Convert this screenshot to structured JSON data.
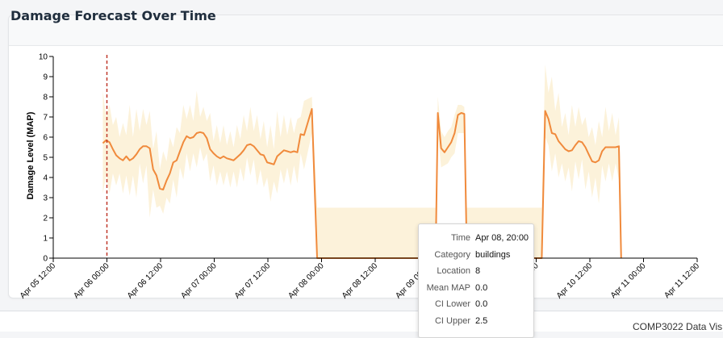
{
  "card": {
    "title": "Damage Forecast Over Time"
  },
  "footer": {
    "text": "COMP3022 Data Vis"
  },
  "colors": {
    "line": "#f08a3c",
    "band": "#fcf2da",
    "marker": "#c0392b",
    "axis": "#000000"
  },
  "tooltip": {
    "rows": [
      {
        "key": "Time",
        "value": "Apr 08, 20:00"
      },
      {
        "key": "Category",
        "value": "buildings"
      },
      {
        "key": "Location",
        "value": "8"
      },
      {
        "key": "Mean MAP",
        "value": "0.0"
      },
      {
        "key": "CI Lower",
        "value": "0.0"
      },
      {
        "key": "CI Upper",
        "value": "2.5"
      }
    ]
  },
  "chart_data": {
    "type": "line",
    "title": "Damage Forecast Over Time",
    "ylabel": "Damage Level (MAP)",
    "xlabel": "",
    "x_range": [
      "2020-04-05T12:00",
      "2020-04-11T12:00"
    ],
    "ylim": [
      0,
      10
    ],
    "y_ticks": [
      "0",
      "1",
      "2",
      "3",
      "4",
      "5",
      "6",
      "7",
      "8",
      "9",
      "10"
    ],
    "x_ticks": [
      {
        "t": "2020-04-05T12:00",
        "label": "Apr 05 12:00"
      },
      {
        "t": "2020-04-06T00:00",
        "label": "Apr 06 00:00"
      },
      {
        "t": "2020-04-06T12:00",
        "label": "Apr 06 12:00"
      },
      {
        "t": "2020-04-07T00:00",
        "label": "Apr 07 00:00"
      },
      {
        "t": "2020-04-07T12:00",
        "label": "Apr 07 12:00"
      },
      {
        "t": "2020-04-08T00:00",
        "label": "Apr 08 00:00"
      },
      {
        "t": "2020-04-08T12:00",
        "label": "Apr 08 12:00"
      },
      {
        "t": "2020-04-09T00:00",
        "label": "Apr 09 00:00"
      },
      {
        "t": "2020-04-09T12:00",
        "label": "Apr 09 12:00"
      },
      {
        "t": "2020-04-10T00:00",
        "label": "Apr 10 00:00"
      },
      {
        "t": "2020-04-10T12:00",
        "label": "Apr 10 12:00"
      },
      {
        "t": "2020-04-11T00:00",
        "label": "Apr 11 00:00"
      },
      {
        "t": "2020-04-11T12:00",
        "label": "Apr 11 12:00"
      }
    ],
    "marker_time": "2020-04-06T00:00",
    "series": [
      {
        "mean": [
          [
            "2020-04-05T23:05",
            5.7
          ],
          [
            "2020-04-05T23:50",
            5.85
          ],
          [
            "2020-04-06T00:35",
            5.75
          ],
          [
            "2020-04-06T01:20",
            5.4
          ],
          [
            "2020-04-06T02:05",
            5.1
          ],
          [
            "2020-04-06T02:50",
            4.95
          ],
          [
            "2020-04-06T03:35",
            4.85
          ],
          [
            "2020-04-06T04:20",
            5.05
          ],
          [
            "2020-04-06T05:05",
            4.85
          ],
          [
            "2020-04-06T05:50",
            4.95
          ],
          [
            "2020-04-06T06:35",
            5.15
          ],
          [
            "2020-04-06T07:20",
            5.4
          ],
          [
            "2020-04-06T08:05",
            5.55
          ],
          [
            "2020-04-06T08:50",
            5.55
          ],
          [
            "2020-04-06T09:35",
            5.45
          ],
          [
            "2020-04-06T10:20",
            4.4
          ],
          [
            "2020-04-06T11:05",
            4.1
          ],
          [
            "2020-04-06T11:50",
            3.45
          ],
          [
            "2020-04-06T12:35",
            3.4
          ],
          [
            "2020-04-06T13:20",
            3.85
          ],
          [
            "2020-04-06T14:05",
            4.2
          ],
          [
            "2020-04-06T14:50",
            4.75
          ],
          [
            "2020-04-06T15:35",
            4.85
          ],
          [
            "2020-04-06T16:20",
            5.3
          ],
          [
            "2020-04-06T17:05",
            5.75
          ],
          [
            "2020-04-06T17:50",
            6.05
          ],
          [
            "2020-04-06T18:35",
            5.95
          ],
          [
            "2020-04-06T19:20",
            6.0
          ],
          [
            "2020-04-06T20:05",
            6.2
          ],
          [
            "2020-04-06T20:50",
            6.25
          ],
          [
            "2020-04-06T21:35",
            6.2
          ],
          [
            "2020-04-06T22:20",
            5.95
          ],
          [
            "2020-04-06T23:05",
            5.4
          ],
          [
            "2020-04-06T23:50",
            5.2
          ],
          [
            "2020-04-07T00:35",
            5.05
          ],
          [
            "2020-04-07T01:20",
            4.95
          ],
          [
            "2020-04-07T02:05",
            5.05
          ],
          [
            "2020-04-07T02:50",
            4.95
          ],
          [
            "2020-04-07T03:35",
            4.9
          ],
          [
            "2020-04-07T04:20",
            4.85
          ],
          [
            "2020-04-07T05:05",
            5.0
          ],
          [
            "2020-04-07T05:50",
            5.15
          ],
          [
            "2020-04-07T06:35",
            5.35
          ],
          [
            "2020-04-07T07:20",
            5.6
          ],
          [
            "2020-04-07T08:05",
            5.65
          ],
          [
            "2020-04-07T08:50",
            5.55
          ],
          [
            "2020-04-07T09:35",
            5.35
          ],
          [
            "2020-04-07T10:20",
            5.15
          ],
          [
            "2020-04-07T11:05",
            5.1
          ],
          [
            "2020-04-07T11:50",
            4.75
          ],
          [
            "2020-04-07T12:35",
            4.7
          ],
          [
            "2020-04-07T13:20",
            4.65
          ],
          [
            "2020-04-07T14:05",
            5.05
          ],
          [
            "2020-04-07T14:50",
            5.2
          ],
          [
            "2020-04-07T15:35",
            5.35
          ],
          [
            "2020-04-07T16:20",
            5.3
          ],
          [
            "2020-04-07T17:05",
            5.25
          ],
          [
            "2020-04-07T17:50",
            5.3
          ],
          [
            "2020-04-07T18:35",
            5.25
          ],
          [
            "2020-04-07T19:20",
            6.15
          ],
          [
            "2020-04-07T20:05",
            6.1
          ],
          [
            "2020-04-07T21:50",
            7.4
          ],
          [
            "2020-04-07T23:00",
            0.0
          ],
          [
            "2020-04-09T00:00",
            0.0
          ],
          [
            "2020-04-09T01:30",
            0.0
          ],
          [
            "2020-04-09T02:00",
            7.2
          ],
          [
            "2020-04-09T02:45",
            5.45
          ],
          [
            "2020-04-09T03:30",
            5.25
          ],
          [
            "2020-04-09T04:15",
            5.5
          ],
          [
            "2020-04-09T05:00",
            5.75
          ],
          [
            "2020-04-09T05:45",
            6.2
          ],
          [
            "2020-04-09T06:30",
            7.1
          ],
          [
            "2020-04-09T07:15",
            7.2
          ],
          [
            "2020-04-09T07:55",
            7.15
          ],
          [
            "2020-04-09T08:30",
            0.0
          ],
          [
            "2020-04-10T01:15",
            0.0
          ],
          [
            "2020-04-10T02:00",
            7.3
          ],
          [
            "2020-04-10T02:45",
            6.9
          ],
          [
            "2020-04-10T03:30",
            6.2
          ],
          [
            "2020-04-10T04:15",
            6.15
          ],
          [
            "2020-04-10T05:00",
            5.8
          ],
          [
            "2020-04-10T05:45",
            5.6
          ],
          [
            "2020-04-10T06:30",
            5.4
          ],
          [
            "2020-04-10T07:15",
            5.3
          ],
          [
            "2020-04-10T08:00",
            5.35
          ],
          [
            "2020-04-10T08:45",
            5.6
          ],
          [
            "2020-04-10T09:30",
            5.8
          ],
          [
            "2020-04-10T10:15",
            5.75
          ],
          [
            "2020-04-10T11:00",
            5.5
          ],
          [
            "2020-04-10T11:45",
            5.15
          ],
          [
            "2020-04-10T12:30",
            4.8
          ],
          [
            "2020-04-10T13:15",
            4.75
          ],
          [
            "2020-04-10T14:00",
            4.85
          ],
          [
            "2020-04-10T14:45",
            5.3
          ],
          [
            "2020-04-10T15:30",
            5.5
          ],
          [
            "2020-04-10T16:15",
            5.5
          ],
          [
            "2020-04-10T17:00",
            5.5
          ],
          [
            "2020-04-10T17:45",
            5.5
          ],
          [
            "2020-04-10T18:30",
            5.55
          ],
          [
            "2020-04-10T19:00",
            0.0
          ]
        ],
        "band": [
          [
            "2020-04-05T23:05",
            3.2,
            8.3
          ],
          [
            "2020-04-05T23:50",
            4.1,
            7.0
          ],
          [
            "2020-04-06T00:35",
            3.2,
            7.6
          ],
          [
            "2020-04-06T01:20",
            4.2,
            6.6
          ],
          [
            "2020-04-06T02:05",
            3.6,
            7.0
          ],
          [
            "2020-04-06T02:50",
            4.2,
            6.0
          ],
          [
            "2020-04-06T03:35",
            3.2,
            6.7
          ],
          [
            "2020-04-06T04:20",
            4.1,
            6.1
          ],
          [
            "2020-04-06T05:05",
            3.1,
            7.6
          ],
          [
            "2020-04-06T05:50",
            4.1,
            6.0
          ],
          [
            "2020-04-06T06:35",
            3.0,
            7.4
          ],
          [
            "2020-04-06T07:20",
            4.7,
            6.3
          ],
          [
            "2020-04-06T08:05",
            3.7,
            7.4
          ],
          [
            "2020-04-06T08:50",
            4.6,
            6.6
          ],
          [
            "2020-04-06T09:35",
            2.0,
            7.3
          ],
          [
            "2020-04-06T10:20",
            3.4,
            5.4
          ],
          [
            "2020-04-06T11:05",
            2.5,
            6.3
          ],
          [
            "2020-04-06T11:50",
            2.6,
            4.4
          ],
          [
            "2020-04-06T12:35",
            2.2,
            5.3
          ],
          [
            "2020-04-06T13:20",
            3.0,
            4.8
          ],
          [
            "2020-04-06T14:05",
            2.7,
            6.0
          ],
          [
            "2020-04-06T14:50",
            3.9,
            5.5
          ],
          [
            "2020-04-06T15:35",
            3.0,
            6.5
          ],
          [
            "2020-04-06T16:20",
            4.5,
            6.2
          ],
          [
            "2020-04-06T17:05",
            3.9,
            7.6
          ],
          [
            "2020-04-06T17:50",
            5.2,
            6.9
          ],
          [
            "2020-04-06T18:35",
            4.3,
            7.6
          ],
          [
            "2020-04-06T19:20",
            5.2,
            6.8
          ],
          [
            "2020-04-06T20:05",
            4.5,
            8.3
          ],
          [
            "2020-04-06T20:50",
            5.5,
            7.0
          ],
          [
            "2020-04-06T21:35",
            4.8,
            7.5
          ],
          [
            "2020-04-06T22:20",
            5.2,
            6.8
          ],
          [
            "2020-04-06T23:05",
            3.8,
            7.2
          ],
          [
            "2020-04-06T23:50",
            4.6,
            5.8
          ],
          [
            "2020-04-07T00:35",
            3.6,
            6.6
          ],
          [
            "2020-04-07T01:20",
            4.3,
            5.7
          ],
          [
            "2020-04-07T02:05",
            3.6,
            6.6
          ],
          [
            "2020-04-07T02:50",
            4.3,
            5.6
          ],
          [
            "2020-04-07T03:35",
            3.5,
            6.3
          ],
          [
            "2020-04-07T04:20",
            4.3,
            5.5
          ],
          [
            "2020-04-07T05:05",
            3.5,
            6.6
          ],
          [
            "2020-04-07T05:50",
            4.5,
            5.9
          ],
          [
            "2020-04-07T06:35",
            3.8,
            7.1
          ],
          [
            "2020-04-07T07:20",
            5.0,
            6.3
          ],
          [
            "2020-04-07T08:05",
            4.1,
            7.5
          ],
          [
            "2020-04-07T08:50",
            4.9,
            6.3
          ],
          [
            "2020-04-07T09:35",
            3.6,
            7.1
          ],
          [
            "2020-04-07T10:20",
            4.4,
            5.9
          ],
          [
            "2020-04-07T11:05",
            3.5,
            6.8
          ],
          [
            "2020-04-07T11:50",
            4.0,
            5.5
          ],
          [
            "2020-04-07T12:35",
            2.8,
            6.6
          ],
          [
            "2020-04-07T13:20",
            3.8,
            5.4
          ],
          [
            "2020-04-07T14:05",
            3.2,
            7.3
          ],
          [
            "2020-04-07T14:50",
            4.4,
            6.0
          ],
          [
            "2020-04-07T15:35",
            3.7,
            7.1
          ],
          [
            "2020-04-07T16:20",
            4.5,
            6.1
          ],
          [
            "2020-04-07T17:05",
            3.6,
            7.0
          ],
          [
            "2020-04-07T17:50",
            4.6,
            6.2
          ],
          [
            "2020-04-07T18:35",
            3.7,
            6.9
          ],
          [
            "2020-04-07T19:20",
            5.2,
            7.0
          ],
          [
            "2020-04-07T20:05",
            4.4,
            7.8
          ],
          [
            "2020-04-07T21:50",
            6.2,
            8.0
          ],
          [
            "2020-04-07T23:00",
            0.0,
            2.5
          ],
          [
            "2020-04-09T00:00",
            0.0,
            2.5
          ],
          [
            "2020-04-09T01:30",
            0.0,
            2.5
          ],
          [
            "2020-04-09T02:00",
            6.2,
            8.0
          ],
          [
            "2020-04-09T02:45",
            4.5,
            6.3
          ],
          [
            "2020-04-09T03:30",
            4.6,
            6.0
          ],
          [
            "2020-04-09T04:15",
            4.7,
            6.3
          ],
          [
            "2020-04-09T05:00",
            5.0,
            6.5
          ],
          [
            "2020-04-09T05:45",
            5.2,
            7.1
          ],
          [
            "2020-04-09T06:30",
            6.2,
            7.6
          ],
          [
            "2020-04-09T07:15",
            6.2,
            7.6
          ],
          [
            "2020-04-09T07:55",
            6.2,
            7.5
          ],
          [
            "2020-04-09T08:30",
            0.0,
            2.5
          ],
          [
            "2020-04-10T01:15",
            0.0,
            2.5
          ],
          [
            "2020-04-10T02:00",
            6.0,
            9.6
          ],
          [
            "2020-04-10T02:45",
            5.6,
            8.2
          ],
          [
            "2020-04-10T03:30",
            4.3,
            9.0
          ],
          [
            "2020-04-10T04:15",
            5.2,
            7.3
          ],
          [
            "2020-04-10T05:00",
            4.0,
            8.2
          ],
          [
            "2020-04-10T05:45",
            4.7,
            6.5
          ],
          [
            "2020-04-10T06:30",
            3.8,
            7.2
          ],
          [
            "2020-04-10T07:15",
            4.5,
            6.1
          ],
          [
            "2020-04-10T08:00",
            3.3,
            7.6
          ],
          [
            "2020-04-10T08:45",
            4.8,
            6.5
          ],
          [
            "2020-04-10T09:30",
            3.9,
            7.5
          ],
          [
            "2020-04-10T10:15",
            4.9,
            6.6
          ],
          [
            "2020-04-10T11:00",
            3.4,
            7.0
          ],
          [
            "2020-04-10T11:45",
            4.3,
            6.0
          ],
          [
            "2020-04-10T12:30",
            3.0,
            6.5
          ],
          [
            "2020-04-10T13:15",
            4.0,
            5.6
          ],
          [
            "2020-04-10T14:00",
            2.7,
            6.8
          ],
          [
            "2020-04-10T14:45",
            4.6,
            6.0
          ],
          [
            "2020-04-10T15:30",
            3.8,
            7.5
          ],
          [
            "2020-04-10T16:15",
            4.7,
            6.3
          ],
          [
            "2020-04-10T17:00",
            3.8,
            7.2
          ],
          [
            "2020-04-10T17:45",
            4.7,
            6.1
          ],
          [
            "2020-04-10T18:30",
            3.9,
            7.0
          ],
          [
            "2020-04-10T19:00",
            0.0,
            2.5
          ]
        ]
      }
    ]
  }
}
